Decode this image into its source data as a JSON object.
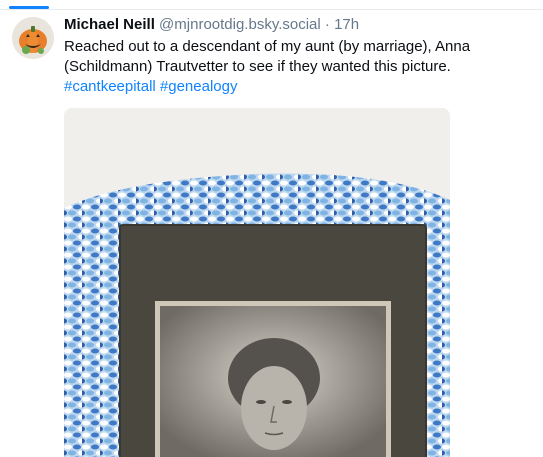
{
  "post": {
    "author_name": "Michael Neill",
    "author_handle": "@mjnrootdig.bsky.social",
    "separator": "·",
    "time": "17h",
    "text_line1": "Reached out to a descendant of my aunt (by marriage), Anna",
    "text_line2": "(Schildmann) Trautvetter to see if they wanted this picture.",
    "hashtags": [
      "#cantkeepitall",
      "#genealogy"
    ]
  },
  "colors": {
    "accent": "#1083fe",
    "muted_text": "#66788a",
    "text": "#0b0f14"
  },
  "icons": {
    "avatar": "pumpkin-avatar-icon"
  }
}
